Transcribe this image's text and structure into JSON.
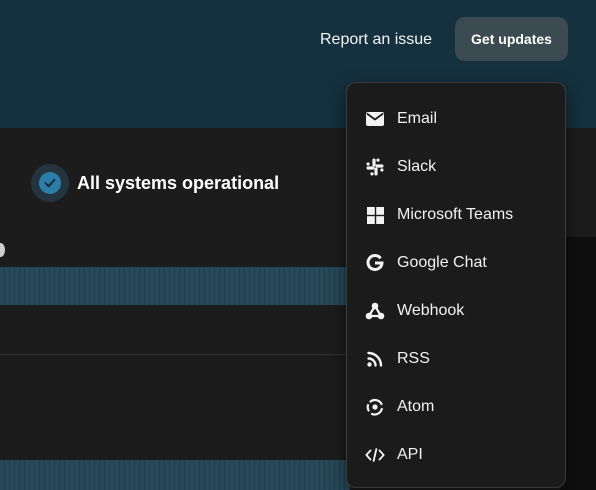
{
  "header": {
    "report_link": "Report an issue",
    "updates_button": "Get updates"
  },
  "status": {
    "text": "All systems operational",
    "icon": "check-circle-icon"
  },
  "menu": {
    "items": [
      {
        "label": "Email",
        "icon": "mail-icon"
      },
      {
        "label": "Slack",
        "icon": "slack-icon"
      },
      {
        "label": "Microsoft Teams",
        "icon": "microsoft-teams-icon"
      },
      {
        "label": "Google Chat",
        "icon": "google-chat-icon"
      },
      {
        "label": "Webhook",
        "icon": "webhook-icon"
      },
      {
        "label": "RSS",
        "icon": "rss-icon"
      },
      {
        "label": "Atom",
        "icon": "atom-icon"
      },
      {
        "label": "API",
        "icon": "api-code-icon"
      }
    ]
  },
  "colors": {
    "hero_background": "#15303f",
    "panel_background": "#1c1c1c",
    "accent_blue": "#2c7ea9",
    "uptime_bar": "#28495a",
    "menu_background": "#1b1b1b",
    "button_background": "#3c4a51"
  }
}
